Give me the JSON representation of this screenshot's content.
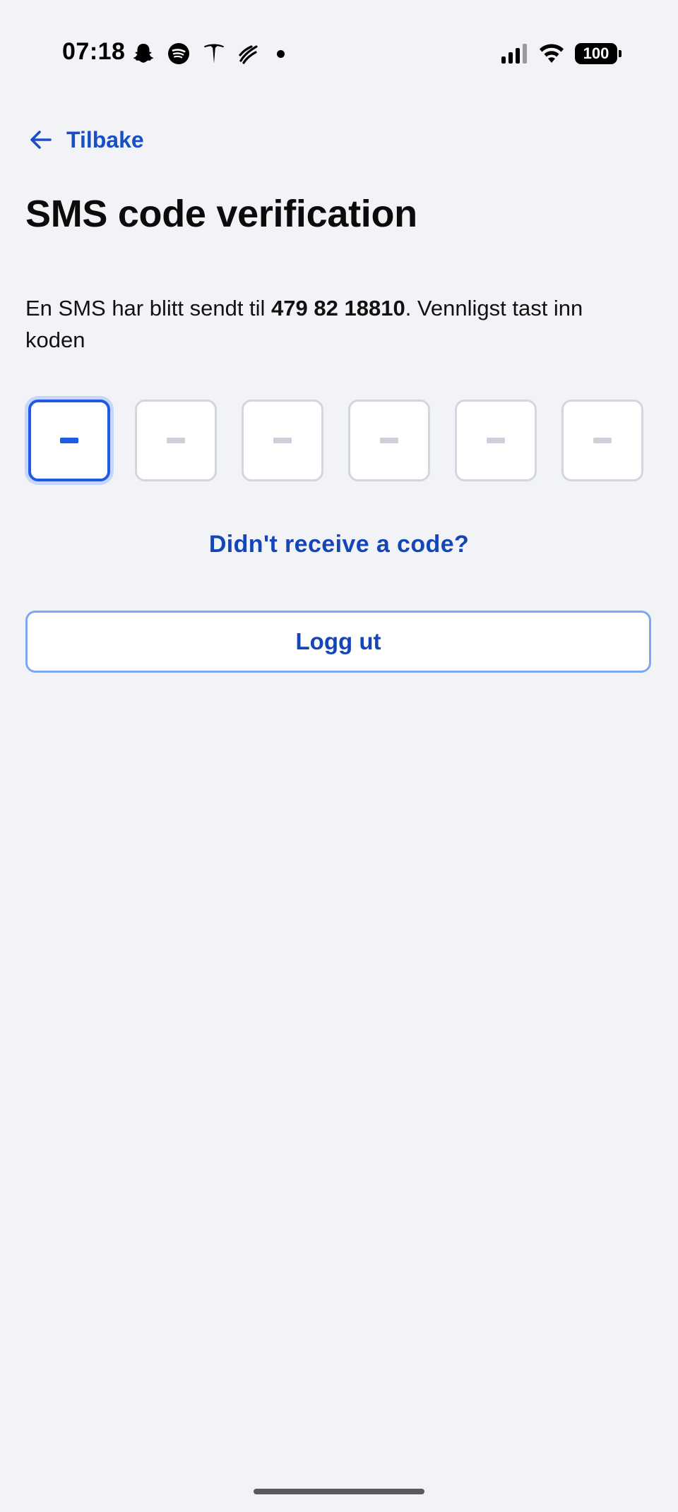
{
  "status_bar": {
    "time": "07:18",
    "battery": "100",
    "left_icons": [
      "snapchat-icon",
      "spotify-icon",
      "tesla-icon",
      "app-icon",
      "notification-dot"
    ],
    "right_icons": [
      "signal-icon",
      "wifi-icon",
      "battery-icon"
    ]
  },
  "nav": {
    "back_label": "Tilbake",
    "back_icon": "arrow-left-icon"
  },
  "page": {
    "title": "SMS code verification",
    "description_prefix": "En SMS har blitt sendt til ",
    "phone_number": "479 82 18810",
    "description_suffix": ". Vennligst tast inn koden"
  },
  "code_input": {
    "digits": [
      "",
      "",
      "",
      "",
      "",
      ""
    ],
    "active_index": 0
  },
  "actions": {
    "resend_label": "Didn't receive a code?",
    "logout_label": "Logg ut"
  },
  "colors": {
    "accent": "#1e5ae3",
    "link": "#1446b8",
    "background": "#f2f3f7",
    "button_border": "#7fa6f0"
  }
}
